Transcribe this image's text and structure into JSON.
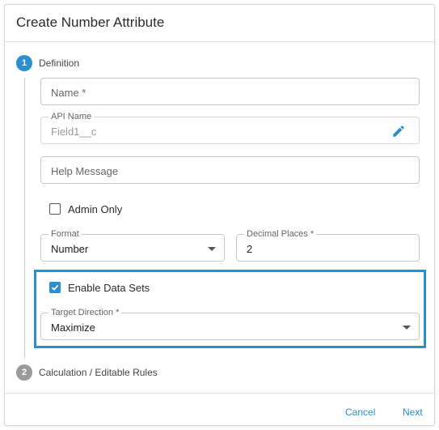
{
  "dialog": {
    "title": "Create Number Attribute"
  },
  "steps": [
    {
      "number": "1",
      "label": "Definition"
    },
    {
      "number": "2",
      "label": "Calculation / Editable Rules"
    }
  ],
  "fields": {
    "name": {
      "placeholder": "Name *"
    },
    "api_name": {
      "label": "API Name",
      "value": "Field1__c",
      "icon": "pencil-icon"
    },
    "help_message": {
      "placeholder": "Help Message"
    },
    "admin_only": {
      "label": "Admin Only",
      "checked": false
    },
    "format": {
      "label": "Format",
      "value": "Number"
    },
    "decimal_places": {
      "label": "Decimal Places *",
      "value": "2"
    },
    "enable_data_sets": {
      "label": "Enable Data Sets",
      "checked": true
    },
    "target_direction": {
      "label": "Target Direction *",
      "value": "Maximize"
    }
  },
  "footer": {
    "cancel_label": "Cancel",
    "next_label": "Next"
  },
  "colors": {
    "accent": "#2a8fd0",
    "step_inactive": "#9a9a9a"
  }
}
